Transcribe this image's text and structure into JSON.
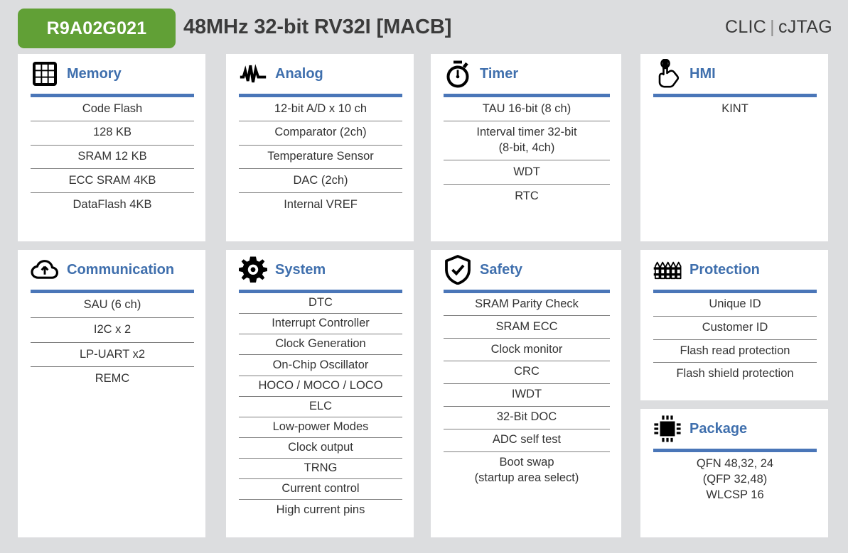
{
  "header": {
    "chip_part_number": "R9A02G021",
    "title": "48MHz 32-bit RV32I [MACB]",
    "right_label_1": "CLIC",
    "right_separator": "|",
    "right_label_2": "cJTAG"
  },
  "colors": {
    "badge_green": "#61a036",
    "accent_blue": "#4a76b8",
    "title_blue": "#3f6fad",
    "page_background": "#dcdddf",
    "card_background": "#ffffff",
    "text": "#333333"
  },
  "cards": [
    {
      "id": "memory",
      "title": "Memory",
      "icon": "grid-icon",
      "items": [
        "Code Flash",
        "128 KB",
        "SRAM 12 KB",
        "ECC SRAM 4KB",
        "DataFlash 4KB"
      ]
    },
    {
      "id": "analog",
      "title": "Analog",
      "icon": "waveform-icon",
      "items": [
        "12-bit A/D x 10 ch",
        "Comparator (2ch)",
        "Temperature Sensor",
        "DAC (2ch)",
        "Internal VREF"
      ]
    },
    {
      "id": "timer",
      "title": "Timer",
      "icon": "stopwatch-icon",
      "items": [
        "TAU 16-bit (8 ch)",
        "Interval timer 32-bit\n(8-bit, 4ch)",
        "WDT",
        "RTC"
      ]
    },
    {
      "id": "hmi",
      "title": "HMI",
      "icon": "touch-hand-icon",
      "items": [
        "KINT"
      ]
    },
    {
      "id": "communication",
      "title": "Communication",
      "icon": "cloud-upload-icon",
      "items": [
        "SAU (6 ch)",
        "I2C x 2",
        "LP-UART x2",
        "REMC"
      ]
    },
    {
      "id": "system",
      "title": "System",
      "icon": "gear-icon",
      "items": [
        "DTC",
        "Interrupt Controller",
        "Clock Generation",
        "On-Chip Oscillator",
        "HOCO / MOCO / LOCO",
        "ELC",
        "Low-power Modes",
        "Clock output",
        "TRNG",
        "Current control",
        "High current pins"
      ]
    },
    {
      "id": "safety",
      "title": "Safety",
      "icon": "shield-check-icon",
      "items": [
        "SRAM Parity Check",
        "SRAM ECC",
        "Clock monitor",
        "CRC",
        "IWDT",
        "32-Bit DOC",
        "ADC self test",
        "Boot swap\n(startup area select)"
      ]
    },
    {
      "id": "protection",
      "title": "Protection",
      "icon": "fence-icon",
      "items": [
        "Unique ID",
        "Customer ID",
        "Flash read protection",
        "Flash shield protection"
      ]
    },
    {
      "id": "package",
      "title": "Package",
      "icon": "chip-icon",
      "items": [
        "QFN 48,32, 24\n(QFP 32,48)\nWLCSP 16"
      ]
    }
  ]
}
